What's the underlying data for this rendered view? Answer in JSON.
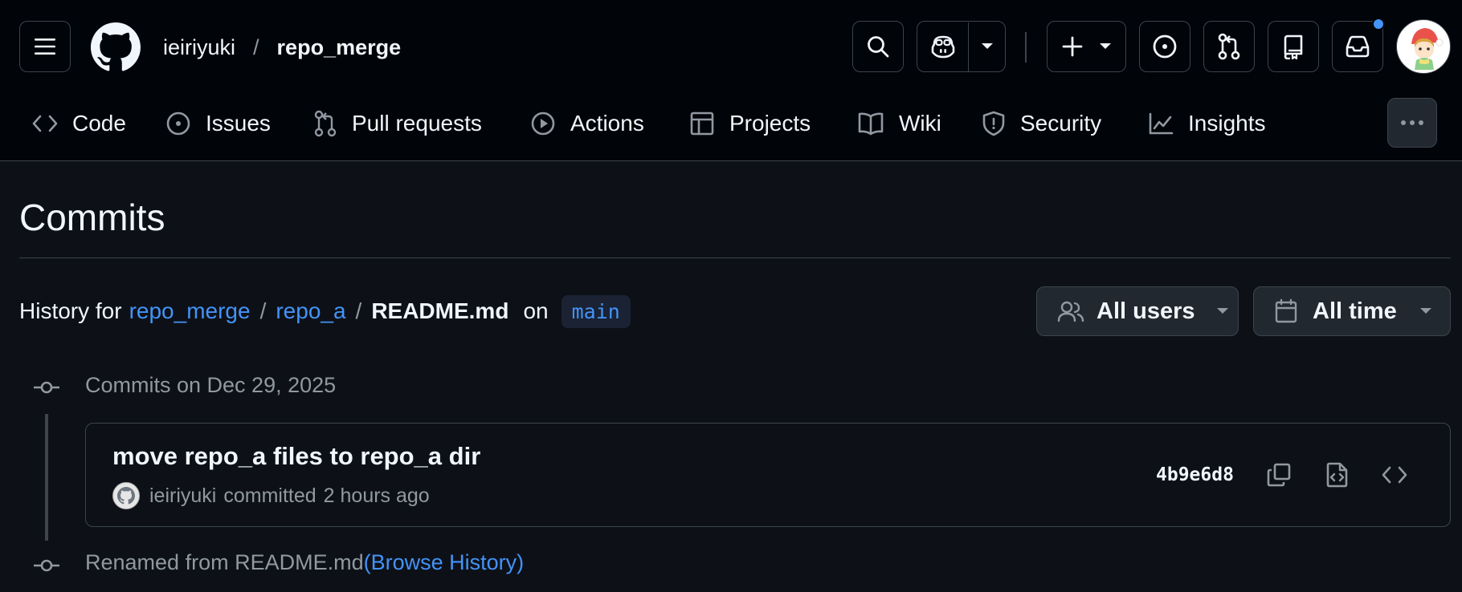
{
  "header": {
    "owner": "ieiriyuki",
    "separator": "/",
    "repo": "repo_merge",
    "icons": [
      "menu-icon",
      "github-logo",
      "search-icon",
      "copilot-icon",
      "plus-icon",
      "issue-icon",
      "pull-request-icon",
      "repo-icon",
      "inbox-icon"
    ],
    "notification_dot_color": "#4493f8"
  },
  "tabs": [
    {
      "label": "Code",
      "icon": "code-icon"
    },
    {
      "label": "Issues",
      "icon": "issue-icon"
    },
    {
      "label": "Pull requests",
      "icon": "pull-request-icon"
    },
    {
      "label": "Actions",
      "icon": "play-icon"
    },
    {
      "label": "Projects",
      "icon": "table-icon"
    },
    {
      "label": "Wiki",
      "icon": "book-icon"
    },
    {
      "label": "Security",
      "icon": "shield-icon"
    },
    {
      "label": "Insights",
      "icon": "graph-icon"
    }
  ],
  "page": {
    "title": "Commits",
    "history_prefix": "History for",
    "path": [
      "repo_merge",
      "repo_a"
    ],
    "path_separator": "/",
    "file": "README.md",
    "on_label": "on",
    "branch": "main"
  },
  "filters": {
    "users": "All users",
    "time": "All time"
  },
  "groups": [
    {
      "title": "Commits on Dec 29, 2025",
      "commits": [
        {
          "message": "move repo_a files to repo_a dir",
          "author": "ieiriyuki",
          "action": "committed",
          "time": "2 hours ago",
          "sha": "4b9e6d8"
        }
      ]
    }
  ],
  "renamed": {
    "text": "Renamed from README.md",
    "link": "(Browse History)"
  },
  "colors": {
    "background": "#0d1117",
    "header_background": "#010409",
    "border": "#3d444d",
    "link": "#4493f8",
    "muted": "#9198a1"
  }
}
